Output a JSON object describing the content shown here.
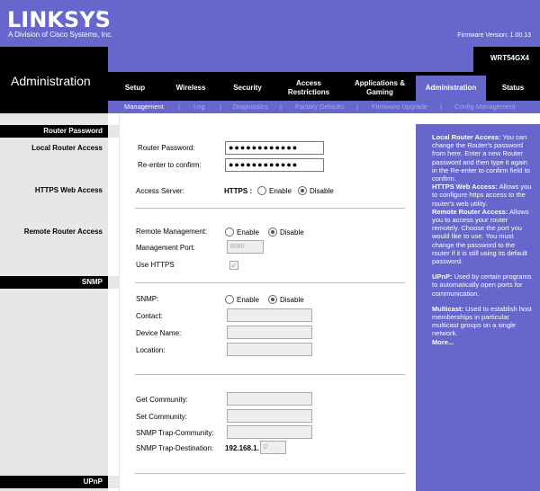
{
  "brand": {
    "logo": "LINKSYS",
    "registered": "®",
    "subtitle": "A Division of Cisco Systems, Inc."
  },
  "firmware": "Firmware Version: 1.00.13",
  "model": "WRT54GX4",
  "section_title": "Administration",
  "tabs": [
    {
      "label": "Setup"
    },
    {
      "label": "Wireless"
    },
    {
      "label": "Security"
    },
    {
      "label": "Access Restrictions"
    },
    {
      "label": "Applications & Gaming"
    },
    {
      "label": "Administration"
    },
    {
      "label": "Status"
    }
  ],
  "subtabs": [
    "Management",
    "Log",
    "Diagnostics",
    "Factory Defaults",
    "Firmware Upgrade",
    "Config Management"
  ],
  "subtab_sep": "|",
  "left": {
    "router_password": "Router Password",
    "local_router_access": "Local Router Access",
    "https_web_access": "HTTPS Web Access",
    "remote_router_access": "Remote Router Access",
    "snmp": "SNMP",
    "upnp": "UPnP"
  },
  "form": {
    "router_password_label": "Router Password:",
    "router_password_value": "●●●●●●●●●●●●",
    "reenter_label": "Re-enter to confirm:",
    "reenter_value": "●●●●●●●●●●●●",
    "access_server_label": "Access Server:",
    "https_label": "HTTPS :",
    "enable": "Enable",
    "disable": "Disable",
    "remote_management_label": "Remote Management:",
    "management_port_label": "Management Port:",
    "management_port_value": "8080",
    "use_https_label": "Use HTTPS",
    "use_https_mark": "✓",
    "snmp_label": "SNMP:",
    "contact_label": "Contact:",
    "device_name_label": "Device Name:",
    "location_label": "Location:",
    "get_community_label": "Get Community:",
    "set_community_label": "Set Community:",
    "snmp_trap_community_label": "SNMP Trap-Community:",
    "snmp_trap_destination_label": "SNMP Trap-Destination:",
    "trap_prefix": "192.168.1.",
    "trap_value": "0"
  },
  "help": {
    "p1_title": "Local Router Access:",
    "p1_text": " You can change the Router's password from here. Enter a new Router password and then type it again in the Re-enter to confirm field to confirm.",
    "p2_title": "HTTPS Web Access:",
    "p2_text": " Allows you to configure https access to the router's web utility.",
    "p3_title": "Remote Router Access:",
    "p3_text": " Allows you to access your router remotely. Choose the port you would like to use. You must change the password to the router if it is still using its default password.",
    "p4_title": "UPnP:",
    "p4_text": " Used by certain programs to automatically open ports for communication.",
    "p5_title": "Multicast:",
    "p5_text": " Used to establish host memberships in particular multicast groups on a single network.",
    "more": "More..."
  },
  "colors": {
    "accent": "#6666cc",
    "black": "#000000",
    "left_grey": "#e7e7e7"
  }
}
